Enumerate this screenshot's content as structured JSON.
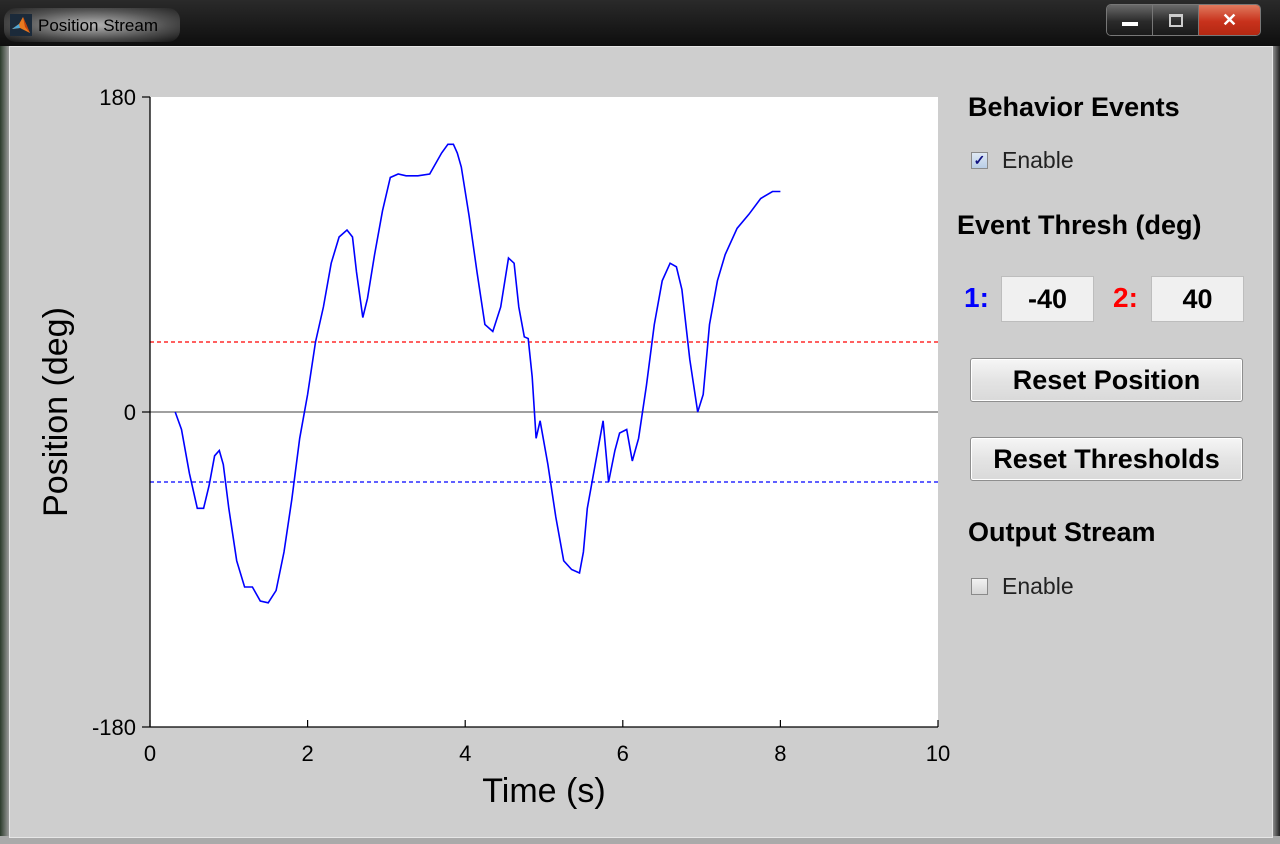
{
  "window": {
    "title": "Position Stream",
    "controls": {
      "minimize": "minimize-icon",
      "maximize": "maximize-icon",
      "close": "close-icon"
    }
  },
  "sidebar": {
    "behavior_events": {
      "heading": "Behavior Events",
      "enable_label": "Enable",
      "enabled": true
    },
    "event_thresh": {
      "heading": "Event Thresh (deg)",
      "thresh1_label": "1:",
      "thresh1_value": "-40",
      "thresh1_color": "#0000ff",
      "thresh2_label": "2:",
      "thresh2_value": "40",
      "thresh2_color": "#ff0000"
    },
    "reset_position_label": "Reset Position",
    "reset_thresholds_label": "Reset Thresholds",
    "output_stream": {
      "heading": "Output Stream",
      "enable_label": "Enable",
      "enabled": false
    }
  },
  "chart_data": {
    "type": "line",
    "title": "",
    "xlabel": "Time (s)",
    "ylabel": "Position (deg)",
    "xlim": [
      0,
      10
    ],
    "ylim": [
      -180,
      180
    ],
    "xticks": [
      0,
      2,
      4,
      6,
      8,
      10
    ],
    "yticks": [
      -180,
      0,
      180
    ],
    "grid": false,
    "reference_lines": [
      {
        "name": "zero-line",
        "y": 0,
        "color": "#808080",
        "style": "solid"
      },
      {
        "name": "threshold-1",
        "y": -40,
        "color": "#0000ff",
        "style": "dashed"
      },
      {
        "name": "threshold-2",
        "y": 40,
        "color": "#ff0000",
        "style": "dashed"
      }
    ],
    "series": [
      {
        "name": "position",
        "color": "#0000ff",
        "x": [
          0.32,
          0.4,
          0.5,
          0.6,
          0.68,
          0.75,
          0.82,
          0.88,
          0.93,
          1.0,
          1.1,
          1.2,
          1.3,
          1.4,
          1.5,
          1.6,
          1.7,
          1.8,
          1.9,
          2.0,
          2.1,
          2.2,
          2.3,
          2.4,
          2.5,
          2.57,
          2.62,
          2.7,
          2.76,
          2.85,
          2.95,
          3.05,
          3.15,
          3.25,
          3.4,
          3.55,
          3.7,
          3.78,
          3.85,
          3.9,
          3.95,
          4.05,
          4.15,
          4.25,
          4.35,
          4.45,
          4.55,
          4.62,
          4.68,
          4.75,
          4.8,
          4.85,
          4.9,
          4.95,
          5.05,
          5.15,
          5.25,
          5.35,
          5.45,
          5.5,
          5.55,
          5.65,
          5.75,
          5.82,
          5.9,
          5.96,
          6.05,
          6.12,
          6.2,
          6.3,
          6.4,
          6.5,
          6.6,
          6.68,
          6.75,
          6.85,
          6.95,
          7.02,
          7.1,
          7.2,
          7.3,
          7.45,
          7.6,
          7.75,
          7.9,
          8.0
        ],
        "y": [
          0,
          -10,
          -35,
          -55,
          -55,
          -42,
          -25,
          -22,
          -30,
          -55,
          -85,
          -100,
          -100,
          -108,
          -109,
          -102,
          -80,
          -50,
          -15,
          10,
          40,
          60,
          85,
          100,
          104,
          100,
          80,
          54,
          65,
          90,
          115,
          134,
          136,
          135,
          135,
          136,
          148,
          153,
          153,
          148,
          140,
          112,
          80,
          50,
          46,
          60,
          88,
          85,
          60,
          43,
          42,
          20,
          -15,
          -5,
          -30,
          -60,
          -85,
          -90,
          -92,
          -80,
          -55,
          -30,
          -5,
          -40,
          -22,
          -12,
          -10,
          -28,
          -15,
          15,
          50,
          75,
          85,
          83,
          70,
          30,
          0,
          10,
          50,
          75,
          90,
          105,
          113,
          122,
          126,
          126
        ]
      }
    ]
  }
}
